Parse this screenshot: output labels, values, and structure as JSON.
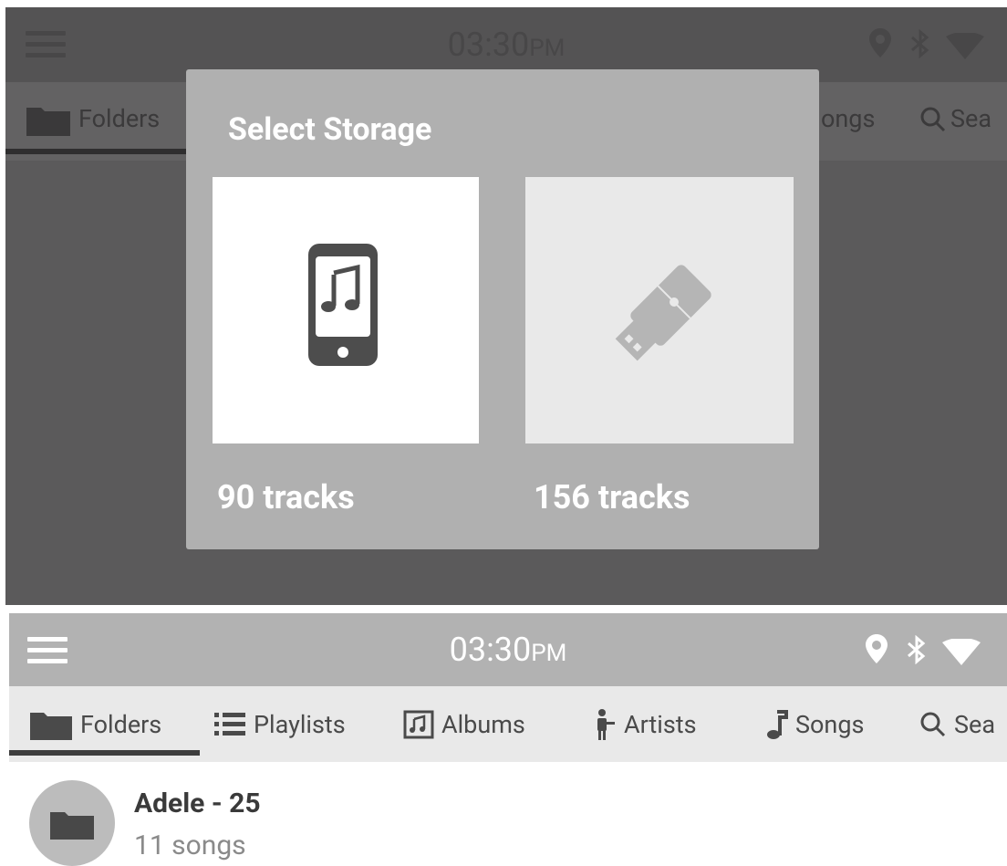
{
  "status_bar": {
    "time": "03:30",
    "ampm": "PM"
  },
  "tabs": [
    {
      "label": "Folders",
      "icon": "folder-icon"
    },
    {
      "label": "Playlists",
      "icon": "list-icon"
    },
    {
      "label": "Albums",
      "icon": "album-icon"
    },
    {
      "label": "Artists",
      "icon": "artist-icon"
    },
    {
      "label": "Songs",
      "icon": "music-note-icon"
    },
    {
      "label": "Sea",
      "icon": "search-icon"
    }
  ],
  "top_tabs_visible": {
    "folders": "Folders",
    "songs_partial": "ongs",
    "search_partial": "Sea"
  },
  "dialog": {
    "title": "Select Storage",
    "options": [
      {
        "label": "90 tracks",
        "icon": "phone-music-icon"
      },
      {
        "label": "156 tracks",
        "icon": "usb-drive-icon"
      }
    ]
  },
  "folder_item": {
    "title": "Adele - 25",
    "subtitle": "11 songs"
  },
  "colors": {
    "dim_background": "#5b5a5b",
    "dialog": "#b0b0b0",
    "status_bar": "#b2b2b2",
    "tab_bar": "#e9e9e9"
  }
}
